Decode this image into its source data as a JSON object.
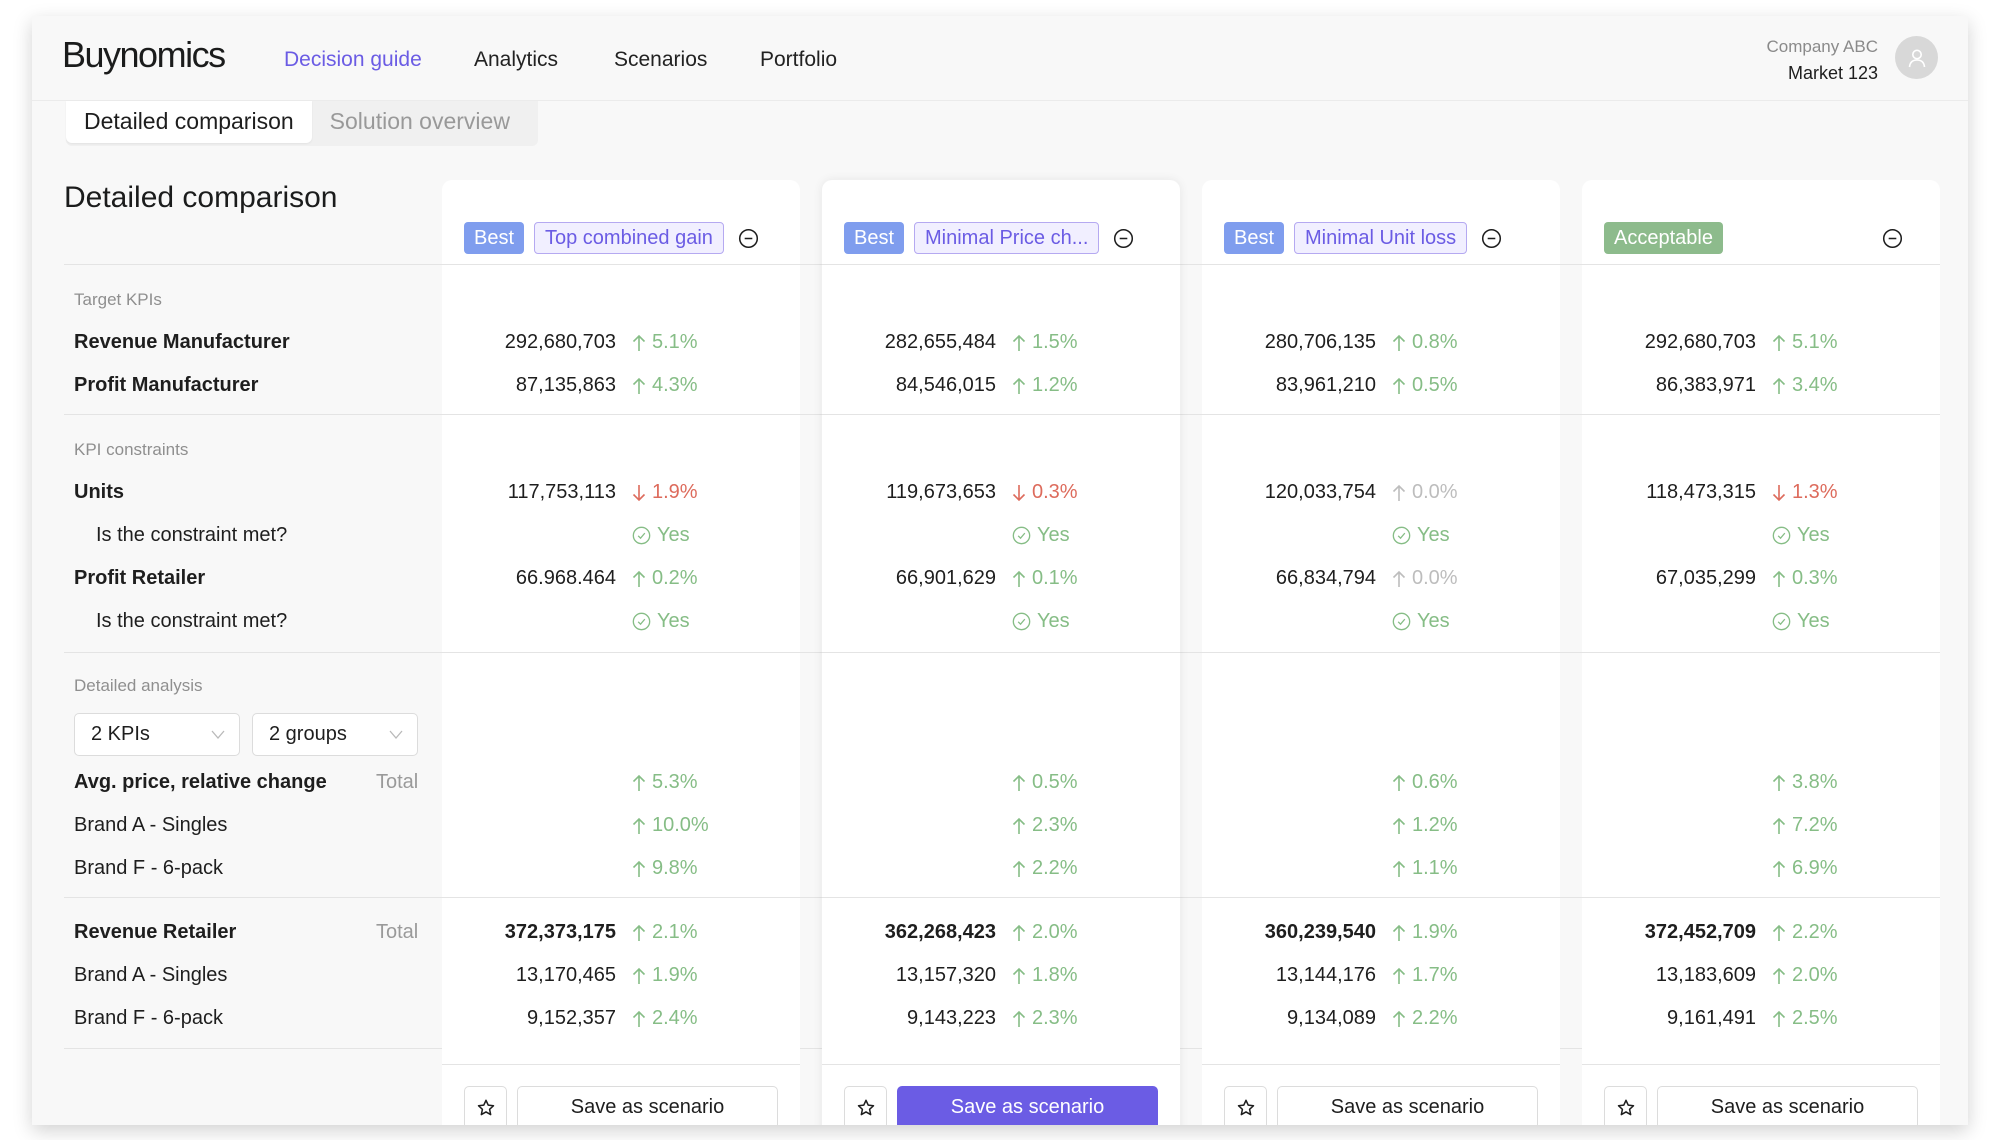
{
  "app": {
    "logo": "Buynomics",
    "nav": [
      {
        "label": "Decision guide",
        "active": true
      },
      {
        "label": "Analytics",
        "active": false
      },
      {
        "label": "Scenarios",
        "active": false
      },
      {
        "label": "Portfolio",
        "active": false
      }
    ],
    "account": {
      "company": "Company ABC",
      "market": "Market 123",
      "avatar_icon": "user-icon"
    }
  },
  "tabs": [
    {
      "label": "Detailed comparison",
      "active": true
    },
    {
      "label": "Solution overview",
      "active": false
    }
  ],
  "page_title": "Detailed comparison",
  "sections": {
    "target_kpis": "Target KPIs",
    "kpi_constraints": "KPI constraints",
    "detailed_analysis": "Detailed analysis"
  },
  "row_labels": {
    "revenue_manufacturer": "Revenue Manufacturer",
    "profit_manufacturer": "Profit Manufacturer",
    "units": "Units",
    "constraint_met": "Is the constraint met?",
    "profit_retailer": "Profit Retailer",
    "avg_price": "Avg. price, relative change",
    "revenue_retailer": "Revenue Retailer",
    "brand_a": "Brand A - Singles",
    "brand_f": "Brand F -  6-pack",
    "total": "Total"
  },
  "filters": {
    "kpis": "2 KPIs",
    "groups": "2 groups"
  },
  "colors": {
    "accent": "#6b5ce4",
    "best_badge": "#7f9dee",
    "acceptable_badge": "#8dbb8c",
    "positive": "#86bd86",
    "negative": "#dd6b5c",
    "neutral": "#bdbdbd"
  },
  "columns": [
    {
      "badge": "Best",
      "badge_type": "best",
      "tag": "Top combined gain",
      "revenue_manufacturer": {
        "value": "292,680,703",
        "delta": "5.1%",
        "dir": "up"
      },
      "profit_manufacturer": {
        "value": "87,135,863",
        "delta": "4.3%",
        "dir": "up"
      },
      "units": {
        "value": "117,753,113",
        "delta": "1.9%",
        "dir": "down"
      },
      "units_met": "Yes",
      "profit_retailer": {
        "value": "66.968.464",
        "delta": "0.2%",
        "dir": "up"
      },
      "profit_retailer_met": "Yes",
      "avg_price_total": {
        "delta": "5.3%",
        "dir": "up"
      },
      "avg_price_brand_a": {
        "delta": "10.0%",
        "dir": "up"
      },
      "avg_price_brand_f": {
        "delta": "9.8%",
        "dir": "up"
      },
      "revenue_retailer_total": {
        "value": "372,373,175",
        "delta": "2.1%",
        "dir": "up"
      },
      "revenue_retailer_brand_a": {
        "value": "13,170,465",
        "delta": "1.9%",
        "dir": "up"
      },
      "revenue_retailer_brand_f": {
        "value": "9,152,357",
        "delta": "2.4%",
        "dir": "up"
      },
      "save_label": "Save as scenario",
      "primary": false
    },
    {
      "badge": "Best",
      "badge_type": "best",
      "tag": "Minimal Price ch...",
      "revenue_manufacturer": {
        "value": "282,655,484",
        "delta": "1.5%",
        "dir": "up"
      },
      "profit_manufacturer": {
        "value": "84,546,015",
        "delta": "1.2%",
        "dir": "up"
      },
      "units": {
        "value": "119,673,653",
        "delta": "0.3%",
        "dir": "down"
      },
      "units_met": "Yes",
      "profit_retailer": {
        "value": "66,901,629",
        "delta": "0.1%",
        "dir": "up"
      },
      "profit_retailer_met": "Yes",
      "avg_price_total": {
        "delta": "0.5%",
        "dir": "up"
      },
      "avg_price_brand_a": {
        "delta": "2.3%",
        "dir": "up"
      },
      "avg_price_brand_f": {
        "delta": "2.2%",
        "dir": "up"
      },
      "revenue_retailer_total": {
        "value": "362,268,423",
        "delta": "2.0%",
        "dir": "up"
      },
      "revenue_retailer_brand_a": {
        "value": "13,157,320",
        "delta": "1.8%",
        "dir": "up"
      },
      "revenue_retailer_brand_f": {
        "value": "9,143,223",
        "delta": "2.3%",
        "dir": "up"
      },
      "save_label": "Save as scenario",
      "primary": true
    },
    {
      "badge": "Best",
      "badge_type": "best",
      "tag": "Minimal Unit loss",
      "revenue_manufacturer": {
        "value": "280,706,135",
        "delta": "0.8%",
        "dir": "up"
      },
      "profit_manufacturer": {
        "value": "83,961,210",
        "delta": "0.5%",
        "dir": "up"
      },
      "units": {
        "value": "120,033,754",
        "delta": "0.0%",
        "dir": "neutral"
      },
      "units_met": "Yes",
      "profit_retailer": {
        "value": "66,834,794",
        "delta": "0.0%",
        "dir": "neutral"
      },
      "profit_retailer_met": "Yes",
      "avg_price_total": {
        "delta": "0.6%",
        "dir": "up"
      },
      "avg_price_brand_a": {
        "delta": "1.2%",
        "dir": "up"
      },
      "avg_price_brand_f": {
        "delta": "1.1%",
        "dir": "up"
      },
      "revenue_retailer_total": {
        "value": "360,239,540",
        "delta": "1.9%",
        "dir": "up"
      },
      "revenue_retailer_brand_a": {
        "value": "13,144,176",
        "delta": "1.7%",
        "dir": "up"
      },
      "revenue_retailer_brand_f": {
        "value": "9,134,089",
        "delta": "2.2%",
        "dir": "up"
      },
      "save_label": "Save as scenario",
      "primary": false
    },
    {
      "badge": "Acceptable",
      "badge_type": "acceptable",
      "tag": null,
      "revenue_manufacturer": {
        "value": "292,680,703",
        "delta": "5.1%",
        "dir": "up"
      },
      "profit_manufacturer": {
        "value": "86,383,971",
        "delta": "3.4%",
        "dir": "up"
      },
      "units": {
        "value": "118,473,315",
        "delta": "1.3%",
        "dir": "down"
      },
      "units_met": "Yes",
      "profit_retailer": {
        "value": "67,035,299",
        "delta": "0.3%",
        "dir": "up"
      },
      "profit_retailer_met": "Yes",
      "avg_price_total": {
        "delta": "3.8%",
        "dir": "up"
      },
      "avg_price_brand_a": {
        "delta": "7.2%",
        "dir": "up"
      },
      "avg_price_brand_f": {
        "delta": "6.9%",
        "dir": "up"
      },
      "revenue_retailer_total": {
        "value": "372,452,709",
        "delta": "2.2%",
        "dir": "up"
      },
      "revenue_retailer_brand_a": {
        "value": "13,183,609",
        "delta": "2.0%",
        "dir": "up"
      },
      "revenue_retailer_brand_f": {
        "value": "9,161,491",
        "delta": "2.5%",
        "dir": "up"
      },
      "save_label": "Save as scenario",
      "primary": false
    }
  ]
}
